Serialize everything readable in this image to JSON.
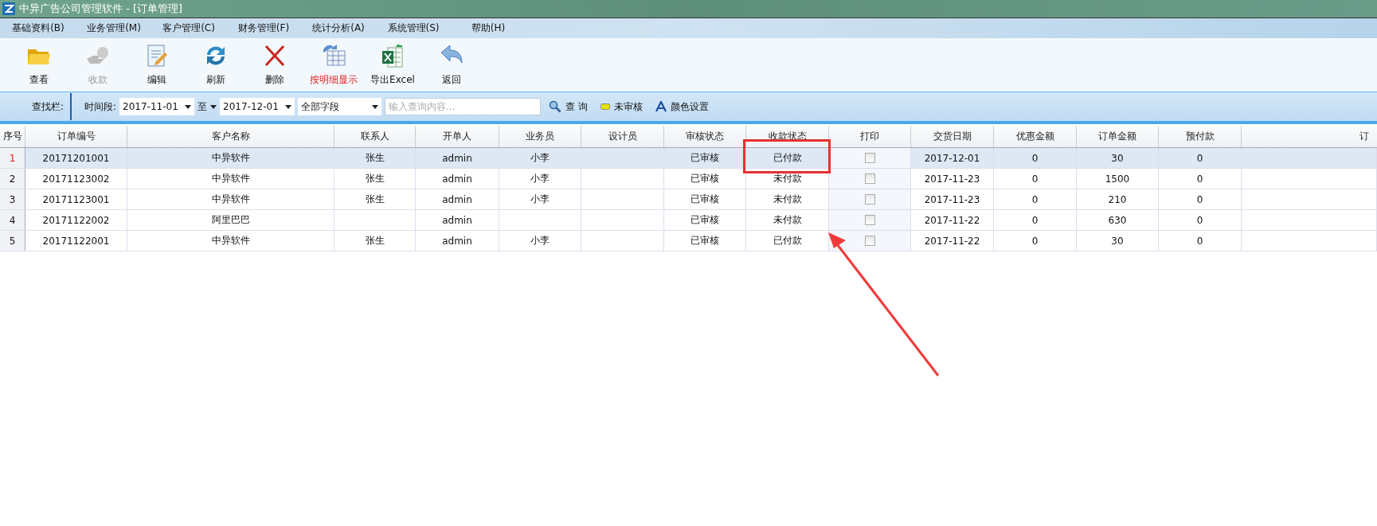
{
  "window": {
    "title": "中异广告公司管理软件 - [订单管理]"
  },
  "menu": [
    {
      "label": "基础资料(B)"
    },
    {
      "label": "业务管理(M)"
    },
    {
      "label": "客户管理(C)"
    },
    {
      "label": "财务管理(F)"
    },
    {
      "label": "统计分析(A)"
    },
    {
      "label": "系统管理(S)"
    },
    {
      "label": "帮助(H)"
    }
  ],
  "toolbar": [
    {
      "kind": "open",
      "label": "查看",
      "disabled": false,
      "highlighted": false
    },
    {
      "kind": "receive",
      "label": "收款",
      "disabled": true,
      "highlighted": false
    },
    {
      "kind": "edit",
      "label": "编辑",
      "disabled": false,
      "highlighted": false
    },
    {
      "kind": "refresh",
      "label": "刷新",
      "disabled": false,
      "highlighted": false
    },
    {
      "kind": "delete",
      "label": "删除",
      "disabled": false,
      "highlighted": false
    },
    {
      "kind": "detail",
      "label": "按明细显示",
      "disabled": false,
      "highlighted": true
    },
    {
      "kind": "excel",
      "label": "导出Excel",
      "disabled": false,
      "highlighted": false
    },
    {
      "kind": "back",
      "label": "返回",
      "disabled": false,
      "highlighted": false
    }
  ],
  "search_bar": {
    "label": "查找栏:",
    "period_label": "时间段:",
    "from": "2017-11-01",
    "to_label": "至",
    "to": "2017-12-01",
    "field": "全部字段",
    "placeholder": "输入查询内容...",
    "search_button": "查 询",
    "legend": "未审核",
    "color_settings": "颜色设置"
  },
  "table": {
    "columns": [
      "序号",
      "订单编号",
      "客户名称",
      "联系人",
      "开单人",
      "业务员",
      "设计员",
      "审核状态",
      "收款状态",
      "打印",
      "交货日期",
      "优惠金额",
      "订单金额",
      "预付款",
      "订"
    ],
    "rows": [
      {
        "selected": true,
        "printed": false,
        "cells": [
          "1",
          "20171201001",
          "中异软件",
          "张生",
          "admin",
          "小李",
          "",
          "已审核",
          "已付款",
          "",
          "2017-12-01",
          "0",
          "30",
          "0",
          ""
        ]
      },
      {
        "selected": false,
        "printed": false,
        "cells": [
          "2",
          "20171123002",
          "中异软件",
          "张生",
          "admin",
          "小李",
          "",
          "已审核",
          "未付款",
          "",
          "2017-11-23",
          "0",
          "1500",
          "0",
          ""
        ]
      },
      {
        "selected": false,
        "printed": false,
        "cells": [
          "3",
          "20171123001",
          "中异软件",
          "张生",
          "admin",
          "小李",
          "",
          "已审核",
          "未付款",
          "",
          "2017-11-23",
          "0",
          "210",
          "0",
          ""
        ]
      },
      {
        "selected": false,
        "printed": false,
        "cells": [
          "4",
          "20171122002",
          "阿里巴巴",
          "",
          "admin",
          "",
          "",
          "已审核",
          "未付款",
          "",
          "2017-11-22",
          "0",
          "630",
          "0",
          ""
        ]
      },
      {
        "selected": false,
        "printed": false,
        "cells": [
          "5",
          "20171122001",
          "中异软件",
          "张生",
          "admin",
          "小李",
          "",
          "已审核",
          "已付款",
          "",
          "2017-11-22",
          "0",
          "30",
          "0",
          ""
        ]
      }
    ]
  }
}
